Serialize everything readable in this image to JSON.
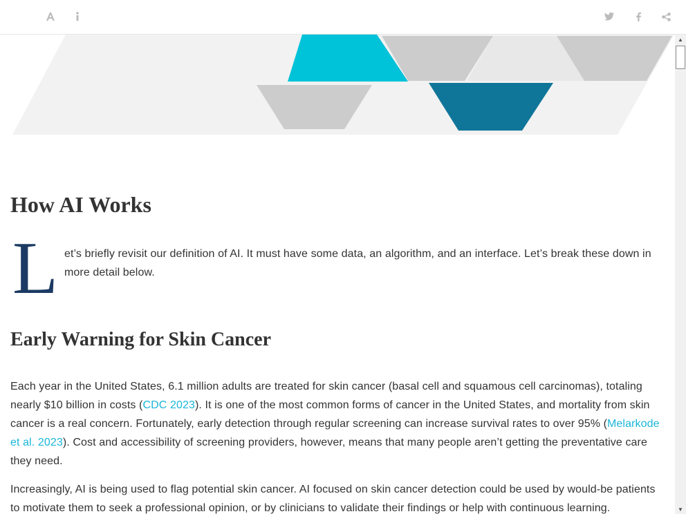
{
  "toolbar": {
    "left_icons": [
      "font-size-icon",
      "info-icon"
    ],
    "right_icons": [
      "twitter-icon",
      "facebook-icon",
      "share-icon"
    ],
    "icon_color": "#bbbbbb"
  },
  "banner": {
    "colors": {
      "background": "#f2f2f2",
      "cyan": "#00c2d9",
      "teal": "#0f7699",
      "gray": "#cccccc",
      "light_gray": "#e8e8e8"
    }
  },
  "article": {
    "heading1": "How AI Works",
    "dropcap": "L",
    "para1": "et’s briefly revisit our definition of AI. It must have some data, an algorithm, and an interface. Let’s break these down in more detail below.",
    "heading2": "Early Warning for Skin Cancer",
    "para2": {
      "part1": "Each year in the United States, 6.1 million adults are treated for skin cancer (basal cell and squamous cell carcinomas), totaling nearly $10 billion in costs (",
      "link1": "CDC 2023",
      "part2": "). It is one of the most common forms of cancer in the United States, and mortality from skin cancer is a real concern. Fortunately, early detection through regular screening can increase survival rates to over 95% (",
      "link2": "Melarkode et al. 2023",
      "part3": "). Cost and accessibility of screening providers, however, means that many people aren’t getting the preventative care they need."
    },
    "para3": "Increasingly, AI is being used to flag potential skin cancer. AI focused on skin cancer detection could be used by would-be patients to motivate them to seek a professional opinion, or by clinicians to validate their findings or help with continuous learning.",
    "colors": {
      "text": "#333333",
      "link": "#1ab6d8",
      "dropcap": "#1b3a63"
    }
  }
}
